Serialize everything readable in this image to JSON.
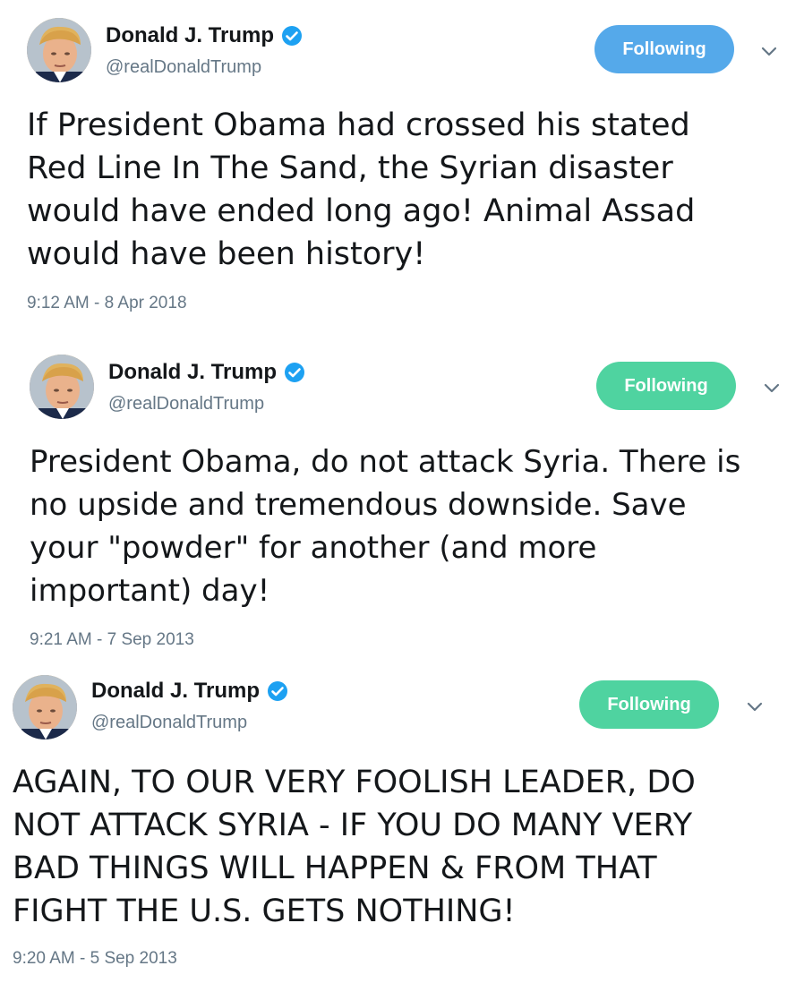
{
  "tweets": [
    {
      "display_name": "Donald J. Trump",
      "handle": "@realDonaldTrump",
      "follow_label": "Following",
      "text": "If President Obama had crossed his stated\nRed Line In The Sand, the Syrian disaster\nwould have ended long ago! Animal Assad\nwould have been history!",
      "timestamp": "9:12 AM - 8 Apr 2018"
    },
    {
      "display_name": "Donald J. Trump",
      "handle": "@realDonaldTrump",
      "follow_label": "Following",
      "text": "President Obama, do not attack Syria. There is\nno upside and tremendous downside. Save\nyour \"powder\" for another (and more\nimportant) day!",
      "timestamp": "9:21 AM - 7 Sep 2013"
    },
    {
      "display_name": "Donald J. Trump",
      "handle": "@realDonaldTrump",
      "follow_label": "Following",
      "text": "AGAIN, TO OUR VERY FOOLISH LEADER, DO\nNOT ATTACK SYRIA - IF YOU DO MANY VERY\nBAD THINGS WILL HAPPEN & FROM THAT\nFIGHT THE U.S. GETS NOTHING!",
      "timestamp": "9:20 AM - 5 Sep 2013"
    }
  ],
  "colors": {
    "following_blue": "#55a9ea",
    "following_green": "#4fd3a0",
    "verified_blue": "#1da1f2",
    "secondary_text": "#657786",
    "primary_text": "#14171a"
  },
  "icons": {
    "verified": "verified-badge-icon",
    "caret": "chevron-down-icon",
    "avatar": "profile-photo"
  }
}
